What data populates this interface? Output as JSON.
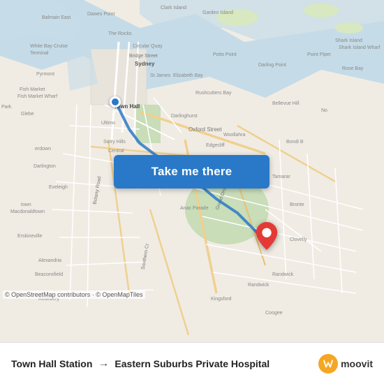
{
  "map": {
    "attribution": "© OpenStreetMap contributors · © OpenMapTiles",
    "origin_lat": -33.873,
    "origin_lng": 151.207,
    "dest_lat": -33.921,
    "dest_lng": 151.231,
    "colors": {
      "land": "#f2efe9",
      "water": "#b3d1e8",
      "roads": "#ffffff",
      "major_roads": "#f5c06e",
      "park": "#d0e8c0",
      "labels": "#666666",
      "route": "#2979c8",
      "button_bg": "#2979c8"
    }
  },
  "button": {
    "label": "Take me there"
  },
  "footer": {
    "origin": "Town Hall Station",
    "arrow": "→",
    "destination": "Eastern Suburbs Private Hospital",
    "logo_letter": "m",
    "logo_text": "moovit"
  }
}
